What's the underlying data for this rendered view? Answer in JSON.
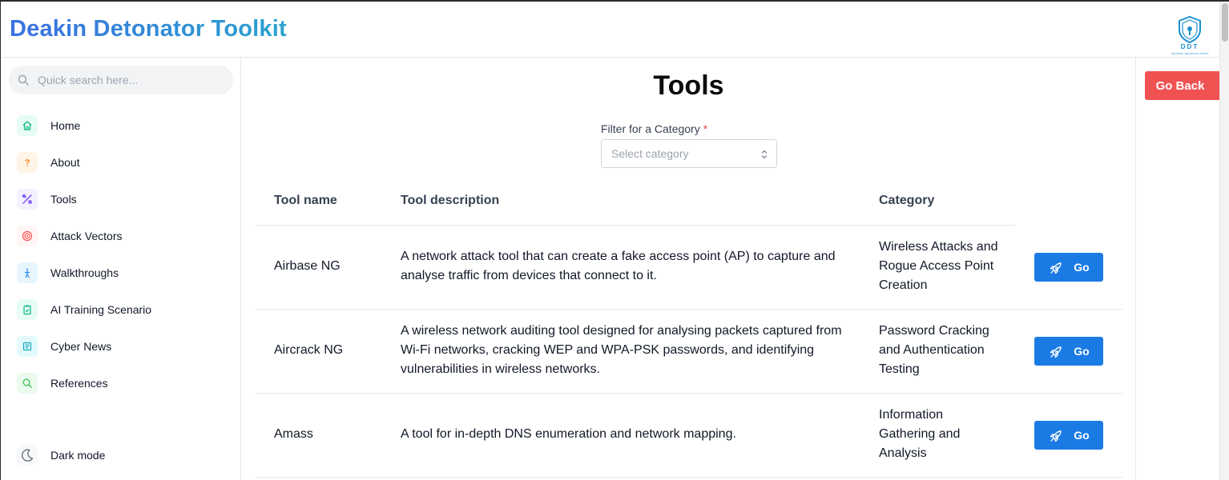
{
  "app": {
    "title": "Deakin Detonator Toolkit",
    "logo_text": "DDT",
    "logo_subtext": "SECURING THE DIGITAL WORLD"
  },
  "search": {
    "placeholder": "Quick search here..."
  },
  "sidebar": {
    "items": [
      {
        "label": "Home",
        "icon": "home-icon",
        "color": "#12b886"
      },
      {
        "label": "About",
        "icon": "question-icon",
        "color": "#fd7e14"
      },
      {
        "label": "Tools",
        "icon": "tools-icon",
        "color": "#7950f2"
      },
      {
        "label": "Attack Vectors",
        "icon": "target-icon",
        "color": "#fa5252"
      },
      {
        "label": "Walkthroughs",
        "icon": "walk-icon",
        "color": "#228be6"
      },
      {
        "label": "AI Training Scenario",
        "icon": "clipboard-icon",
        "color": "#12b886"
      },
      {
        "label": "Cyber News",
        "icon": "news-icon",
        "color": "#15aabf"
      },
      {
        "label": "References",
        "icon": "search-icon",
        "color": "#40c057"
      }
    ],
    "dark_mode_label": "Dark mode"
  },
  "main": {
    "title": "Tools",
    "filter": {
      "label": "Filter for a Category",
      "required_mark": "*",
      "placeholder": "Select category"
    },
    "table": {
      "headers": [
        "Tool name",
        "Tool description",
        "Category"
      ],
      "rows": [
        {
          "name": "Airbase NG",
          "description": "A network attack tool that can create a fake access point (AP) to capture and analyse traffic from devices that connect to it.",
          "category": "Wireless Attacks and Rogue Access Point Creation",
          "action": "Go"
        },
        {
          "name": "Aircrack NG",
          "description": "A wireless network auditing tool designed for analysing packets captured from Wi-Fi networks, cracking WEP and WPA-PSK passwords, and identifying vulnerabilities in wireless networks.",
          "category": "Password Cracking and Authentication Testing",
          "action": "Go"
        },
        {
          "name": "Amass",
          "description": "A tool for in-depth DNS enumeration and network mapping.",
          "category": "Information Gathering and Analysis",
          "action": "Go"
        }
      ]
    }
  },
  "right_panel": {
    "go_back_label": "Go Back"
  },
  "colors": {
    "accent": "#1b7be5",
    "danger": "#f05252",
    "brand_start": "#3b6fe0",
    "brand_end": "#2aa3cf"
  }
}
